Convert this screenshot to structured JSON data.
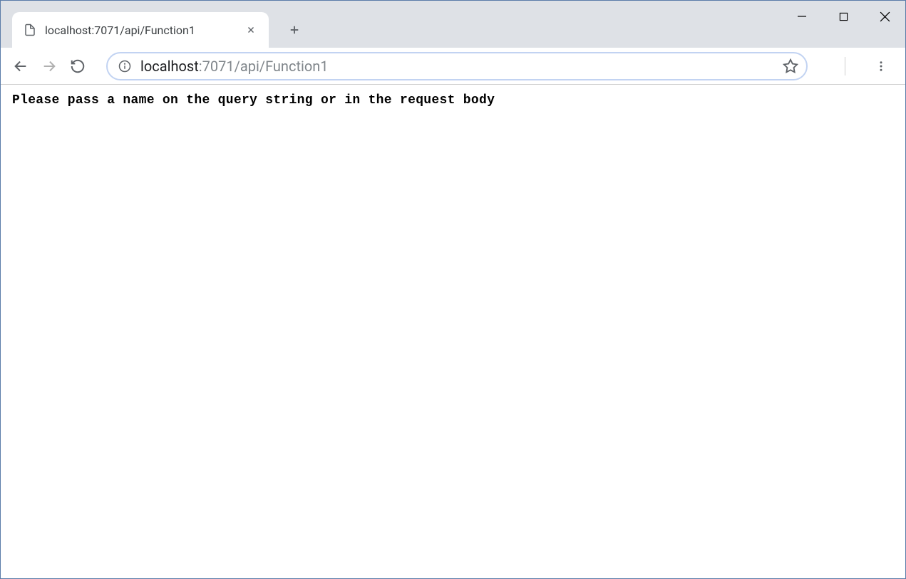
{
  "tab": {
    "title": "localhost:7071/api/Function1"
  },
  "address": {
    "host": "localhost",
    "rest": ":7071/api/Function1"
  },
  "page": {
    "body_text": "Please pass a name on the query string or in the request body"
  }
}
